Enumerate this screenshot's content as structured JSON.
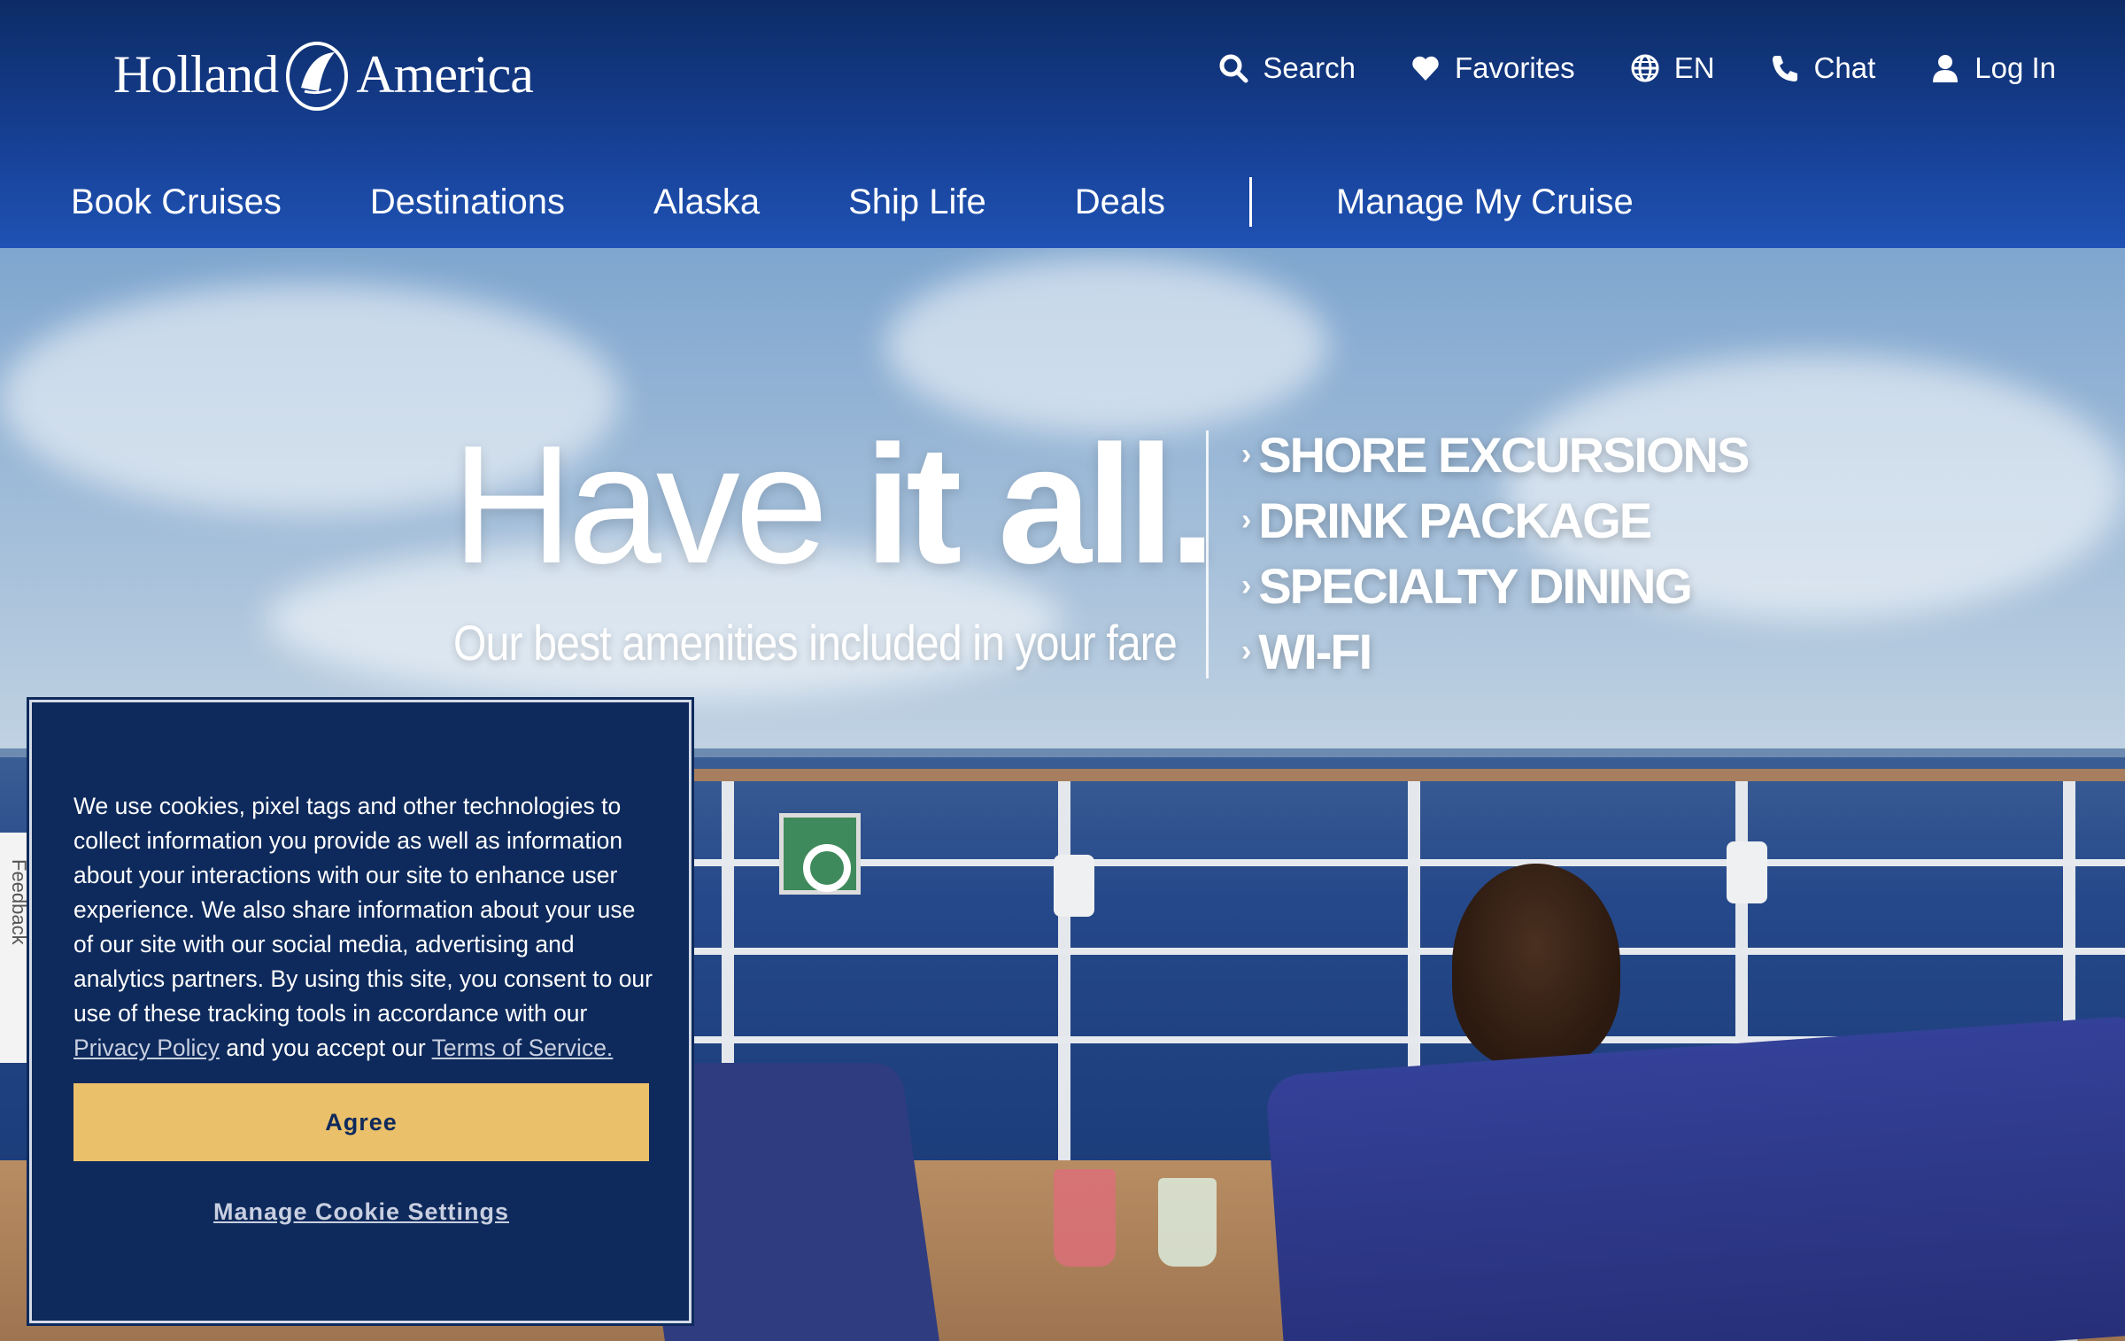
{
  "brand": {
    "name_left": "Holland",
    "name_right": "America"
  },
  "utility_nav": [
    {
      "label": "Search",
      "icon": "search-icon"
    },
    {
      "label": "Favorites",
      "icon": "heart-icon"
    },
    {
      "label": "EN",
      "icon": "globe-icon"
    },
    {
      "label": "Chat",
      "icon": "phone-icon"
    },
    {
      "label": "Log In",
      "icon": "user-icon"
    }
  ],
  "main_nav": [
    {
      "label": "Book Cruises"
    },
    {
      "label": "Destinations"
    },
    {
      "label": "Alaska"
    },
    {
      "label": "Ship Life"
    },
    {
      "label": "Deals"
    }
  ],
  "manage_nav": {
    "label": "Manage My Cruise"
  },
  "hero": {
    "headline_light": "Have ",
    "headline_bold": "it all.",
    "subline": "Our best amenities included in your fare",
    "amenities": [
      "SHORE EXCURSIONS",
      "DRINK PACKAGE",
      "SPECIALTY DINING",
      "WI-FI"
    ]
  },
  "feedback": {
    "label": "Feedback"
  },
  "cookie_banner": {
    "text": "We use cookies, pixel tags and other technologies to collect information you provide as well as information about your interactions with our site to enhance user experience. We also share information about your use of our site with our social media, advertising and analytics partners. By using this site, you consent to our use of these tracking tools in accordance with our",
    "privacy_link": "Privacy Policy",
    "middle_text": "and you accept our",
    "terms_link": "Terms of Service.",
    "agree_label": "Agree",
    "manage_label": "Manage Cookie Settings"
  },
  "colors": {
    "header": "#163f93",
    "dialog": "#0e2a5c",
    "agree": "#eac06a"
  }
}
